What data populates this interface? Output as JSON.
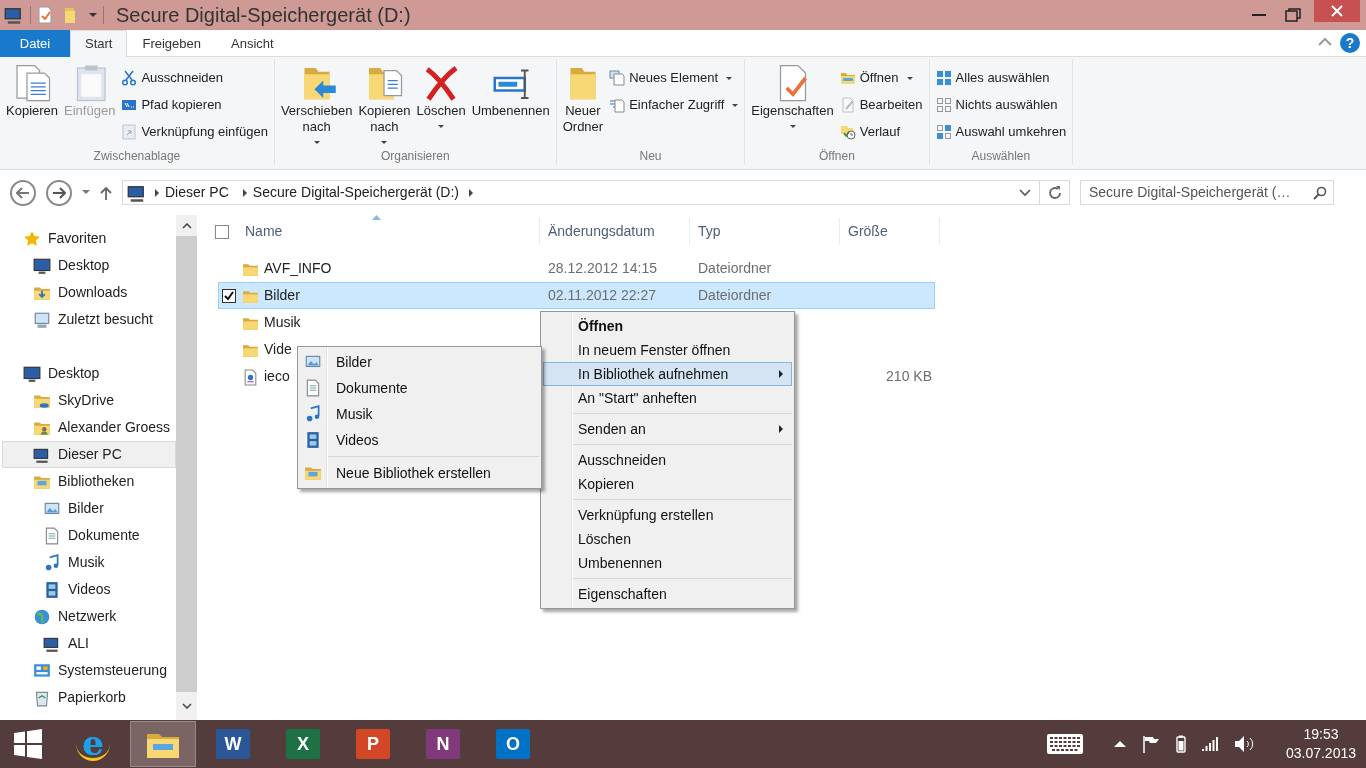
{
  "window": {
    "title": "Secure Digital-Speichergerät (D:)"
  },
  "ribbon_tabs": [
    {
      "label": "Datei",
      "kind": "file",
      "selected": false
    },
    {
      "label": "Start",
      "kind": "tab",
      "selected": true
    },
    {
      "label": "Freigeben",
      "kind": "tab",
      "selected": false
    },
    {
      "label": "Ansicht",
      "kind": "tab",
      "selected": false
    }
  ],
  "help_button": {
    "label": "?"
  },
  "ribbon_groups": [
    {
      "label": "Zwischenablage",
      "large": [
        {
          "label": "Kopieren",
          "disabled": false,
          "dropdown": false
        },
        {
          "label": "Einfügen",
          "disabled": true,
          "dropdown": false
        }
      ],
      "small": [
        {
          "label": "Ausschneiden",
          "disabled": false,
          "dropdown": false
        },
        {
          "label": "Pfad kopieren",
          "disabled": false,
          "dropdown": false
        },
        {
          "label": "Verknüpfung einfügen",
          "disabled": true,
          "dropdown": false
        }
      ]
    },
    {
      "label": "Organisieren",
      "large": [
        {
          "label": "Verschieben nach",
          "disabled": false,
          "dropdown": true
        },
        {
          "label": "Kopieren nach",
          "disabled": false,
          "dropdown": true
        },
        {
          "label": "Löschen",
          "disabled": false,
          "dropdown": true
        },
        {
          "label": "Umbenennen",
          "disabled": false,
          "dropdown": false
        }
      ]
    },
    {
      "label": "Neu",
      "large": [
        {
          "label": "Neuer Ordner",
          "disabled": false,
          "dropdown": false
        }
      ],
      "small": [
        {
          "label": "Neues Element",
          "disabled": false,
          "dropdown": true
        },
        {
          "label": "Einfacher Zugriff",
          "disabled": false,
          "dropdown": true
        }
      ]
    },
    {
      "label": "Öffnen",
      "large": [
        {
          "label": "Eigenschaften",
          "disabled": false,
          "dropdown": true
        }
      ],
      "small": [
        {
          "label": "Öffnen",
          "disabled": false,
          "dropdown": true
        },
        {
          "label": "Bearbeiten",
          "disabled": true,
          "dropdown": false
        },
        {
          "label": "Verlauf",
          "disabled": false,
          "dropdown": false
        }
      ]
    },
    {
      "label": "Auswählen",
      "small": [
        {
          "label": "Alles auswählen",
          "disabled": false,
          "dropdown": false
        },
        {
          "label": "Nichts auswählen",
          "disabled": false,
          "dropdown": false
        },
        {
          "label": "Auswahl umkehren",
          "disabled": false,
          "dropdown": false
        }
      ]
    }
  ],
  "address_bar": {
    "crumbs": [
      "Dieser PC",
      "Secure Digital-Speichergerät (D:)"
    ]
  },
  "search": {
    "placeholder": "Secure Digital-Speichergerät (…"
  },
  "navigation": [
    {
      "label": "Favoriten",
      "selected": false,
      "children": [
        {
          "label": "Desktop",
          "selected": false
        },
        {
          "label": "Downloads",
          "selected": false
        },
        {
          "label": "Zuletzt besucht",
          "selected": false
        }
      ]
    },
    {
      "label": "Desktop",
      "selected": false,
      "children": [
        {
          "label": "SkyDrive",
          "selected": false
        },
        {
          "label": "Alexander Groess",
          "selected": false
        },
        {
          "label": "Dieser PC",
          "selected": true
        },
        {
          "label": "Bibliotheken",
          "selected": false,
          "children": [
            {
              "label": "Bilder",
              "selected": false
            },
            {
              "label": "Dokumente",
              "selected": false
            },
            {
              "label": "Musik",
              "selected": false
            },
            {
              "label": "Videos",
              "selected": false
            }
          ]
        },
        {
          "label": "Netzwerk",
          "selected": false,
          "children": [
            {
              "label": "ALI",
              "selected": false
            }
          ]
        },
        {
          "label": "Systemsteuerung",
          "selected": false
        },
        {
          "label": "Papierkorb",
          "selected": false
        }
      ]
    }
  ],
  "file_list": {
    "all_checked": false,
    "columns": [
      "Name",
      "Änderungsdatum",
      "Typ",
      "Größe"
    ],
    "rows": [
      {
        "name": "AVF_INFO",
        "date": "28.12.2012 14:15",
        "type": "Dateiordner",
        "kind": "folder",
        "selected": false,
        "checked": false
      },
      {
        "name": "Bilder",
        "date": "02.11.2012 22:27",
        "type": "Dateiordner",
        "kind": "folder",
        "selected": true,
        "checked": true
      },
      {
        "name": "Musik",
        "kind": "folder",
        "selected": false,
        "checked": false
      },
      {
        "name": "Vide",
        "kind": "folder",
        "selected": false,
        "checked": false
      },
      {
        "name": "ieco",
        "size": "210 KB",
        "kind": "file",
        "selected": false,
        "checked": false
      }
    ]
  },
  "context_menu": {
    "items": [
      {
        "kind": "item",
        "label": "Öffnen",
        "default": true,
        "selected": false,
        "submenu": false
      },
      {
        "kind": "item",
        "label": "In neuem Fenster öffnen",
        "default": false,
        "selected": false,
        "submenu": false
      },
      {
        "kind": "item",
        "label": "In Bibliothek aufnehmen",
        "default": false,
        "selected": true,
        "submenu": true
      },
      {
        "kind": "item",
        "label": "An \"Start\" anheften",
        "default": false,
        "selected": false,
        "submenu": false
      },
      {
        "kind": "separator"
      },
      {
        "kind": "item",
        "label": "Senden an",
        "default": false,
        "selected": false,
        "submenu": true
      },
      {
        "kind": "separator"
      },
      {
        "kind": "item",
        "label": "Ausschneiden",
        "default": false,
        "selected": false,
        "submenu": false
      },
      {
        "kind": "item",
        "label": "Kopieren",
        "default": false,
        "selected": false,
        "submenu": false
      },
      {
        "kind": "separator"
      },
      {
        "kind": "item",
        "label": "Verknüpfung erstellen",
        "default": false,
        "selected": false,
        "submenu": false
      },
      {
        "kind": "item",
        "label": "Löschen",
        "default": false,
        "selected": false,
        "submenu": false
      },
      {
        "kind": "item",
        "label": "Umbenennen",
        "default": false,
        "selected": false,
        "submenu": false
      },
      {
        "kind": "separator"
      },
      {
        "kind": "item",
        "label": "Eigenschaften",
        "default": false,
        "selected": false,
        "submenu": false
      }
    ]
  },
  "library_submenu": {
    "items": [
      {
        "kind": "item",
        "label": "Bilder"
      },
      {
        "kind": "item",
        "label": "Dokumente"
      },
      {
        "kind": "item",
        "label": "Musik"
      },
      {
        "kind": "item",
        "label": "Videos"
      },
      {
        "kind": "separator"
      },
      {
        "kind": "item",
        "label": "Neue Bibliothek erstellen"
      }
    ]
  },
  "taskbar": {
    "apps": [
      {
        "kind": "start",
        "active": false
      },
      {
        "kind": "browser",
        "letter": "e",
        "active": false
      },
      {
        "kind": "explorer",
        "active": true
      },
      {
        "kind": "office",
        "letter": "W",
        "color": "#2b5797",
        "active": false
      },
      {
        "kind": "office",
        "letter": "X",
        "color": "#1e7145",
        "active": false
      },
      {
        "kind": "office",
        "letter": "P",
        "color": "#d24726",
        "active": false
      },
      {
        "kind": "office",
        "letter": "N",
        "color": "#80397b",
        "active": false
      },
      {
        "kind": "office",
        "letter": "O",
        "color": "#0072c6",
        "active": false
      }
    ],
    "time": "19:53",
    "date": "03.07.2013"
  }
}
